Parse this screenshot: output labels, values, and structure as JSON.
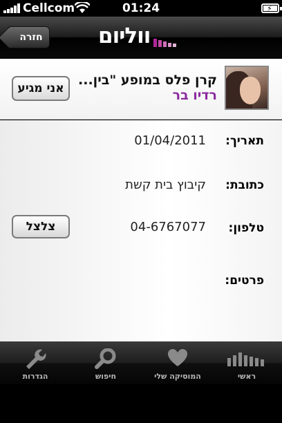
{
  "status_bar": {
    "carrier": "Cellcom",
    "time": "01:24"
  },
  "nav": {
    "back_label": "חזרה",
    "logo_text": "ווליום"
  },
  "event": {
    "title": "קרן פלס במופע \"בין...",
    "venue": "רדיו בר",
    "arrive_button": "אני מגיע"
  },
  "details": {
    "date_label": "תאריך:",
    "date_value": "01/04/2011",
    "address_label": "כתובת:",
    "address_value": "קיבוץ בית קשת",
    "phone_label": "טלפון:",
    "phone_value": "04-6767077",
    "call_button": "צלצל",
    "info_label": "פרטים:"
  },
  "tabs": [
    {
      "label": "ראשי",
      "icon": "bars-icon"
    },
    {
      "label": "המוסיקה שלי",
      "icon": "heart-icon"
    },
    {
      "label": "חיפוש",
      "icon": "search-icon"
    },
    {
      "label": "הגדרות",
      "icon": "wrench-icon"
    }
  ],
  "colors": {
    "venue": "#8a2a9e",
    "logo_accent": "#b0279a"
  }
}
